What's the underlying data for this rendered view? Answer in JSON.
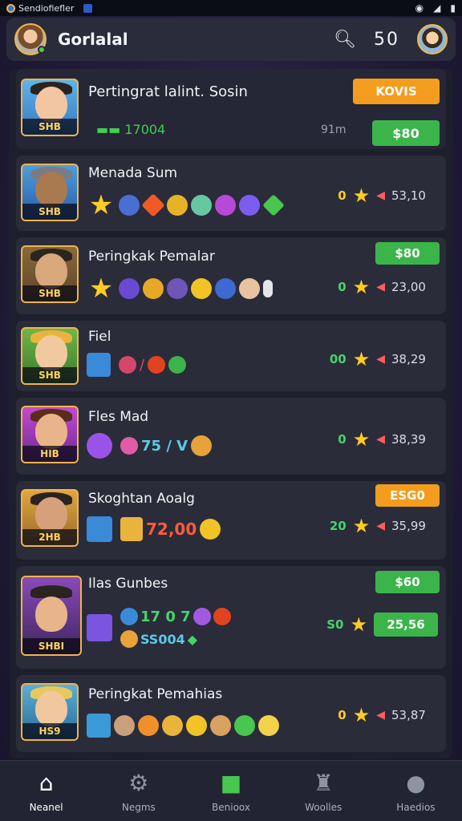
{
  "status_bar": {
    "app_name": "Sendiofiefler",
    "icons": [
      "location-icon",
      "signal-icon",
      "battery-icon"
    ]
  },
  "header": {
    "title": "Gorlalal",
    "coins": "50",
    "search_icon": "search-icon"
  },
  "colors": {
    "accent_green": "#3bb54a",
    "accent_orange": "#f39c1e",
    "star": "#ffcc21",
    "card": "#2a2c3a"
  },
  "rows": [
    {
      "name": "Pertingrat lalint. Sosin",
      "level_badge": "SHB",
      "left_stat": "17004",
      "mid_stat": "91m",
      "pill_top": "KOVIS",
      "pill_bottom": "$80"
    },
    {
      "name": "Menada Sum",
      "level_badge": "SHB",
      "level": "0",
      "value": "53,10"
    },
    {
      "name": "Peringkak Pemalar",
      "level_badge": "SHB",
      "level": "0",
      "value": "23,00",
      "pill": "$80"
    },
    {
      "name": "Fiel",
      "level_badge": "SHB",
      "level": "00",
      "value": "38,29"
    },
    {
      "name": "Fles Mad",
      "level_badge": "HIB",
      "level": "0",
      "value": "38,39",
      "inline_text": "75 / V"
    },
    {
      "name": "Skoghtan Aoalg",
      "level_badge": "2HB",
      "level": "20",
      "value": "35,99",
      "pill": "ESG0",
      "inline_text": "72,00"
    },
    {
      "name": "Ilas Gunbes",
      "level_badge": "SHBI",
      "level": "S0",
      "value": "25,56",
      "pill": "$60",
      "line1": "17 0 7",
      "line2": "SS004"
    },
    {
      "name": "Peringkat Pemahias",
      "level_badge": "HS9",
      "level": "0",
      "value": "53,87"
    }
  ],
  "nav": [
    {
      "label": "Neanel",
      "icon": "home-icon",
      "active": true
    },
    {
      "label": "Negms",
      "icon": "gear-icon",
      "active": false
    },
    {
      "label": "Benioox",
      "icon": "cube-icon",
      "active": false
    },
    {
      "label": "Woolles",
      "icon": "trophy-icon",
      "active": false
    },
    {
      "label": "Haedios",
      "icon": "profile-icon",
      "active": false
    }
  ]
}
